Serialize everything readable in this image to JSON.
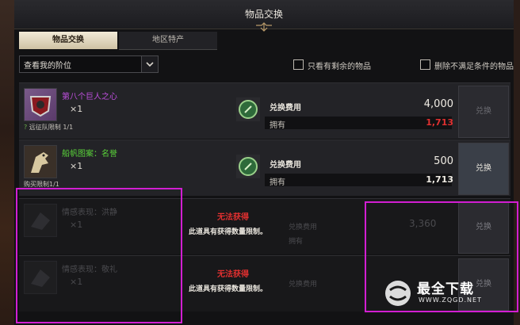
{
  "window": {
    "title": "物品交换"
  },
  "tabs": [
    {
      "label": "物品交换",
      "active": true
    },
    {
      "label": "地区特产",
      "active": false
    }
  ],
  "filter": {
    "select_value": "查看我的阶位",
    "checkbox_remaining": "只看有剩余的物品",
    "checkbox_remove": "删除不满足条件的物品"
  },
  "rows": [
    {
      "name": "第八个巨人之心",
      "name_color": "#c050e0",
      "qty": "×1",
      "limit": "远征队限制 1/1",
      "cost_label": "兑换费用",
      "cost_value": "4,000",
      "own_label": "拥有",
      "own_value": "1,713",
      "own_color": "#e03030",
      "button": "兑换",
      "button_enabled": false
    },
    {
      "name": "船帆图案：名誉",
      "name_color": "#5ad23a",
      "qty": "×1",
      "limit": "购买限制1/1",
      "cost_label": "兑换费用",
      "cost_value": "500",
      "own_label": "拥有",
      "own_value": "1,713",
      "own_color": "#f0ece4",
      "button": "兑换",
      "button_enabled": true
    },
    {
      "name": "情感表现：洪静",
      "qty": "×1",
      "fail_title": "无法获得",
      "fail_desc": "此道具有获得数量限制。",
      "cost_label": "兑换费用",
      "own_label": "拥有",
      "cost_value": "3,360",
      "button": "兑换"
    },
    {
      "name": "情感表现：敬礼",
      "qty": "×1",
      "fail_title": "无法获得",
      "fail_desc": "此道具有获得数量限制。",
      "cost_label": "兑换费用",
      "button": "兑换"
    }
  ],
  "watermark": {
    "text": "最全下载",
    "url": "WWW.ZQGD.NET"
  },
  "colors": {
    "highlight": "#d21ed2",
    "active_tab": "#e8dfc8",
    "fail_red": "#e23030"
  }
}
